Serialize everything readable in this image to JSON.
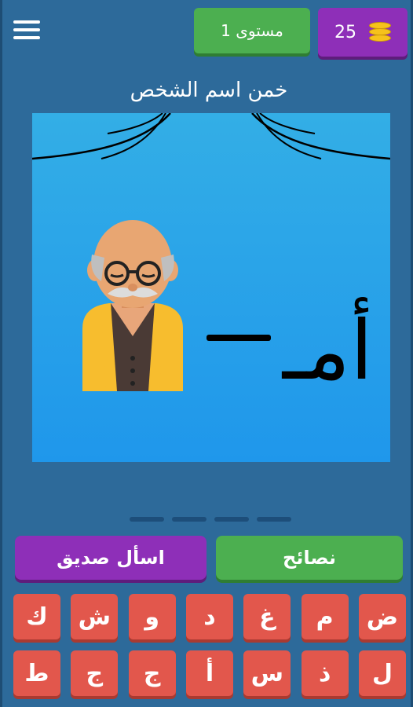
{
  "header": {
    "coins": "25",
    "level_label": "مستوى 1"
  },
  "prompt": "خمن اسم الشخص",
  "puzzle": {
    "clue_text": "أمـ",
    "image": "old-man-with-glasses"
  },
  "answer_slots": 4,
  "actions": {
    "hints_label": "نصائح",
    "ask_friend_label": "اسأل صديق"
  },
  "keyboard": {
    "row1": [
      "ض",
      "م",
      "غ",
      "د",
      "و",
      "ش",
      "ك"
    ],
    "row2": [
      "ل",
      "ذ",
      "س",
      "أ",
      "ج",
      "ج",
      "ط"
    ]
  },
  "colors": {
    "background": "#2d6a9a",
    "green": "#4caf50",
    "purple": "#8e2fb8",
    "key_red": "#e2574c",
    "puzzle_blue": "#22a0e8"
  }
}
